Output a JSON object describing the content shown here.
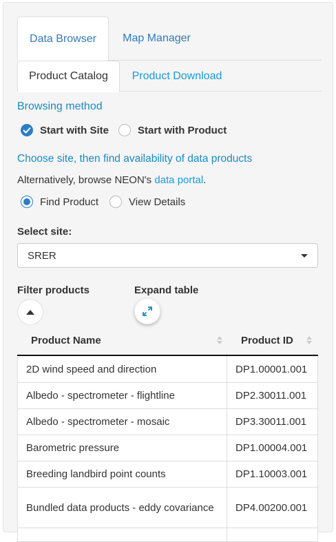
{
  "tabs": {
    "main": [
      "Data Browser",
      "Map Manager"
    ],
    "sub": [
      "Product Catalog",
      "Product Download"
    ]
  },
  "browsing": {
    "title": "Browsing method",
    "options": [
      "Start with Site",
      "Start with Product"
    ],
    "selected": "Start with Site"
  },
  "choose": {
    "title": "Choose site, then find availability of data products",
    "alt_prefix": "Alternatively, browse NEON's ",
    "alt_link": "data portal",
    "alt_suffix": ".",
    "mode_options": [
      "Find Product",
      "View Details"
    ],
    "mode_selected": "Find Product"
  },
  "site": {
    "label": "Select site:",
    "value": "SRER"
  },
  "filter": {
    "filter_label": "Filter products",
    "expand_label": "Expand table"
  },
  "table": {
    "columns": [
      "Product Name",
      "Product ID"
    ],
    "rows": [
      {
        "name": "2D wind speed and direction",
        "id": "DP1.00001.001"
      },
      {
        "name": "Albedo - spectrometer - flightline",
        "id": "DP2.30011.001"
      },
      {
        "name": "Albedo - spectrometer - mosaic",
        "id": "DP3.30011.001"
      },
      {
        "name": "Barometric pressure",
        "id": "DP1.00004.001"
      },
      {
        "name": "Breeding landbird point counts",
        "id": "DP1.10003.001"
      },
      {
        "name": "Bundled data products - eddy covariance",
        "id": "DP4.00200.001"
      }
    ]
  },
  "colors": {
    "accent": "#2e7dc4",
    "link": "#1a9ad6",
    "panel_bg": "#f5f5f5"
  }
}
